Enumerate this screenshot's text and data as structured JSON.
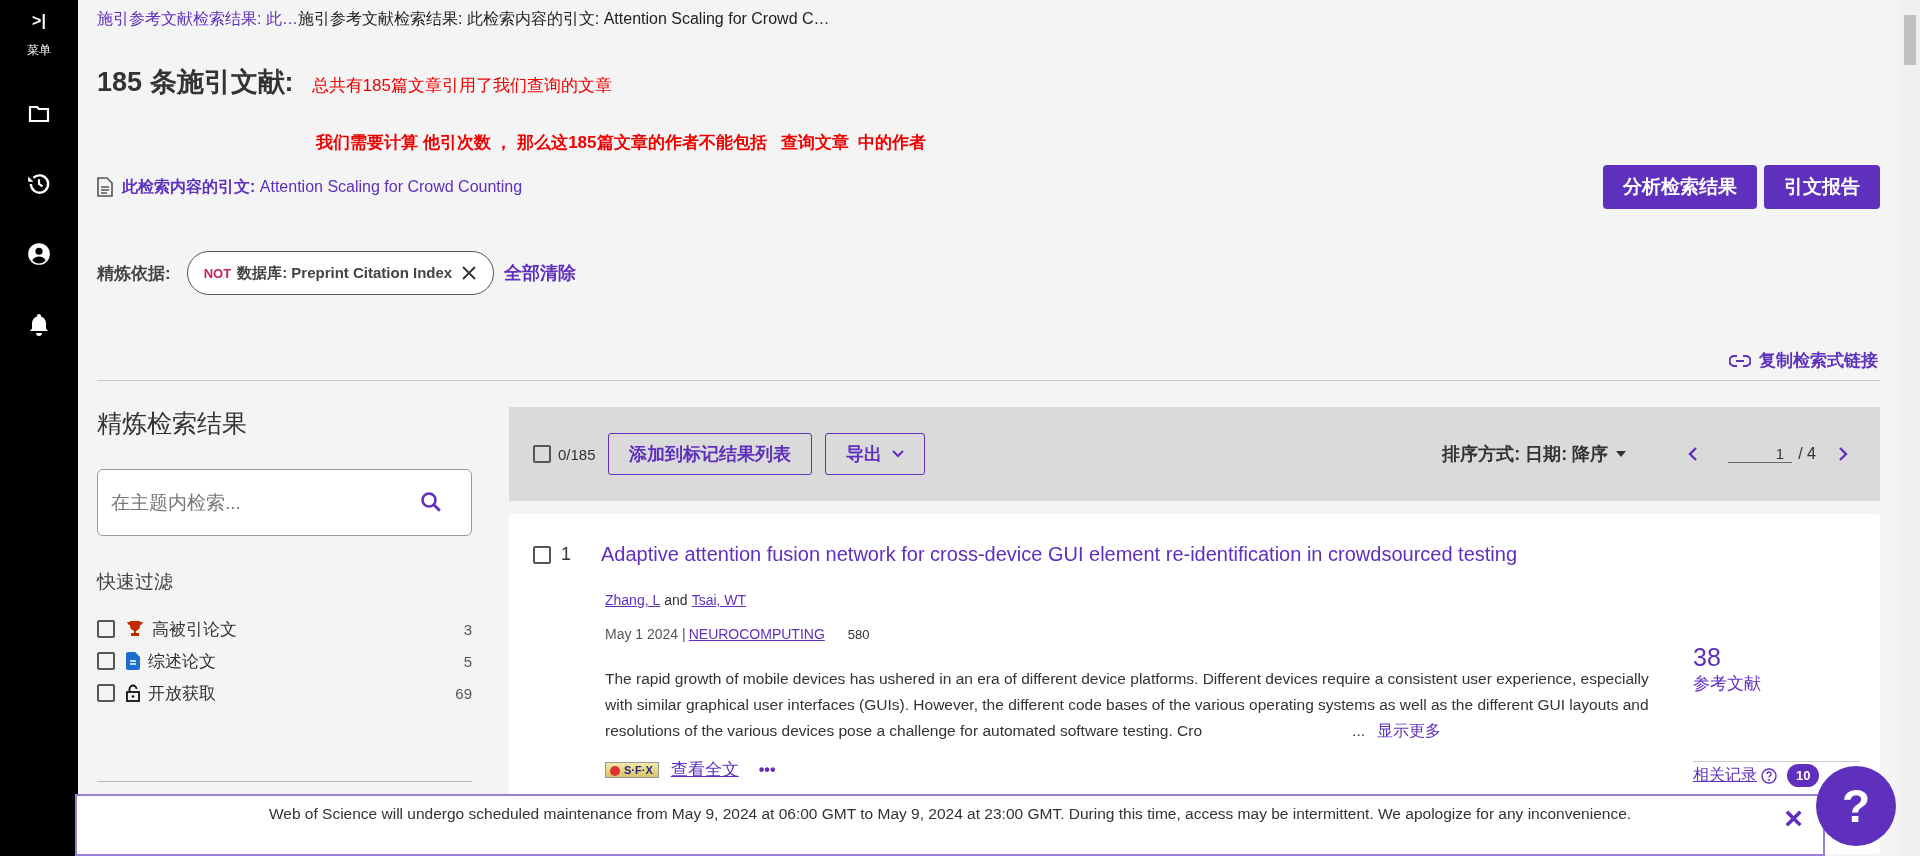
{
  "nav_rail": {
    "expand_glyph": ">|",
    "menu_label": "菜单",
    "items": [
      {
        "kind": "folder"
      },
      {
        "kind": "history"
      },
      {
        "kind": "account"
      },
      {
        "kind": "bell"
      }
    ]
  },
  "breadcrumb": {
    "link": "施引参考文献检索结果: 此…",
    "current": "施引参考文献检索结果: 此检索内容的引文: Attention Scaling for Crowd C…"
  },
  "heading": {
    "title": "185 条施引文献:",
    "note": "总共有185篇文章引用了我们查询的文章"
  },
  "annotation": "我们需要计算 他引次数 ， 那么这185篇文章的作者不能包括   查询文章  中的作者",
  "cited_item": {
    "label": "此检索内容的引文:",
    "title": "Attention Scaling for Crowd Counting"
  },
  "actions": [
    "分析检索结果",
    "引文报告"
  ],
  "refine": {
    "label": "精炼依据:",
    "chips": [
      {
        "operator": "NOT",
        "text": "数据库: Preprint Citation Index"
      }
    ],
    "clear": "全部清除"
  },
  "copy_link": "复制检索式链接",
  "refine_panel": {
    "title": "精炼检索结果",
    "search": {
      "placeholder": "在主题内检索..."
    },
    "quick_filter_title": "快速过滤",
    "filters": [
      {
        "kind": "trophy",
        "label": "高被引论文",
        "count": "3",
        "checked": false
      },
      {
        "kind": "document",
        "label": "综述论文",
        "count": "5",
        "checked": false
      },
      {
        "kind": "lock",
        "label": "开放获取",
        "count": "69",
        "checked": false
      }
    ]
  },
  "toolbar": {
    "checked": false,
    "selected_count": "0/185",
    "add_button": "添加到标记结果列表",
    "export_button": "导出",
    "sort_label": "排序方式: 日期: 降序",
    "page": "1",
    "total_pages": "/ 4"
  },
  "results": [
    {
      "index": "1",
      "checked": false,
      "title": "Adaptive attention fusion network for cross-device GUI element re-identification in crowdsourced testing",
      "authors": [
        "Zhang, L",
        "Tsai, WT"
      ],
      "author_joiner": "and",
      "date": "May 1 2024 |",
      "journal": "NEUROCOMPUTING",
      "volume": "580",
      "abstract": "The rapid growth of mobile devices has ushered in an era of different device platforms. Different devices require a consistent user experience, especially with similar graphical user interfaces (GUIs). However, the different code bases of the various operating systems as well as the different GUI layouts and resolutions of the various devices pose a challenge for automated software testing. Cro",
      "ellipsis": "...",
      "show_more": "显示更多",
      "references_count": "38",
      "references_label": "参考文献",
      "sfx_label": "S·F·X",
      "full_text": "查看全文",
      "more": "•••",
      "related": "相关记录",
      "related_count": "10"
    }
  ],
  "banner": {
    "message": "Web of Science will undergo scheduled maintenance from May 9, 2024 at 06:00 GMT to May 9, 2024 at 23:00 GMT. During this time, access may be intermittent. We apologize for any inconvenience.",
    "close": "×"
  },
  "help_button": "?"
}
